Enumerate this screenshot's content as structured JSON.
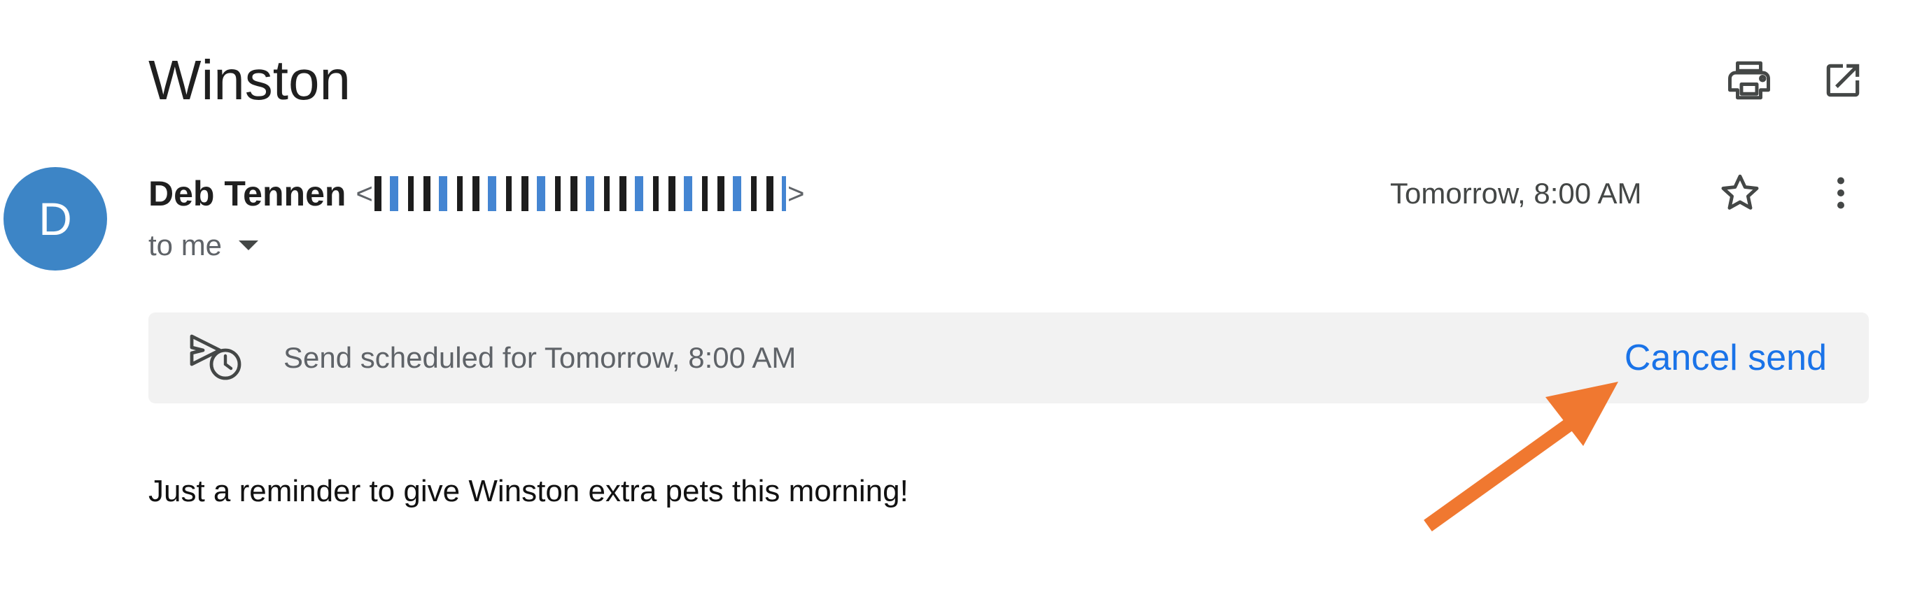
{
  "subject": "Winston",
  "toolbar": {
    "print_icon": "printer-icon",
    "open_new_window_icon": "open-in-new-icon"
  },
  "sender": {
    "avatar_letter": "D",
    "avatar_color": "#3d85c6",
    "name": "Deb Tennen",
    "email_open": "<",
    "email_close": ">",
    "recipient_text": "to me"
  },
  "message_meta": {
    "timestamp": "Tomorrow, 8:00 AM",
    "star_icon": "star-outline-icon",
    "more_icon": "more-vert-icon"
  },
  "scheduled_banner": {
    "icon": "schedule-send-icon",
    "text": "Send scheduled for Tomorrow, 8:00 AM",
    "cancel_label": "Cancel send",
    "link_color": "#1a73e8"
  },
  "body": {
    "text": "Just a reminder to give Winston extra pets this morning!"
  },
  "annotation": {
    "arrow_color": "#f07830"
  }
}
